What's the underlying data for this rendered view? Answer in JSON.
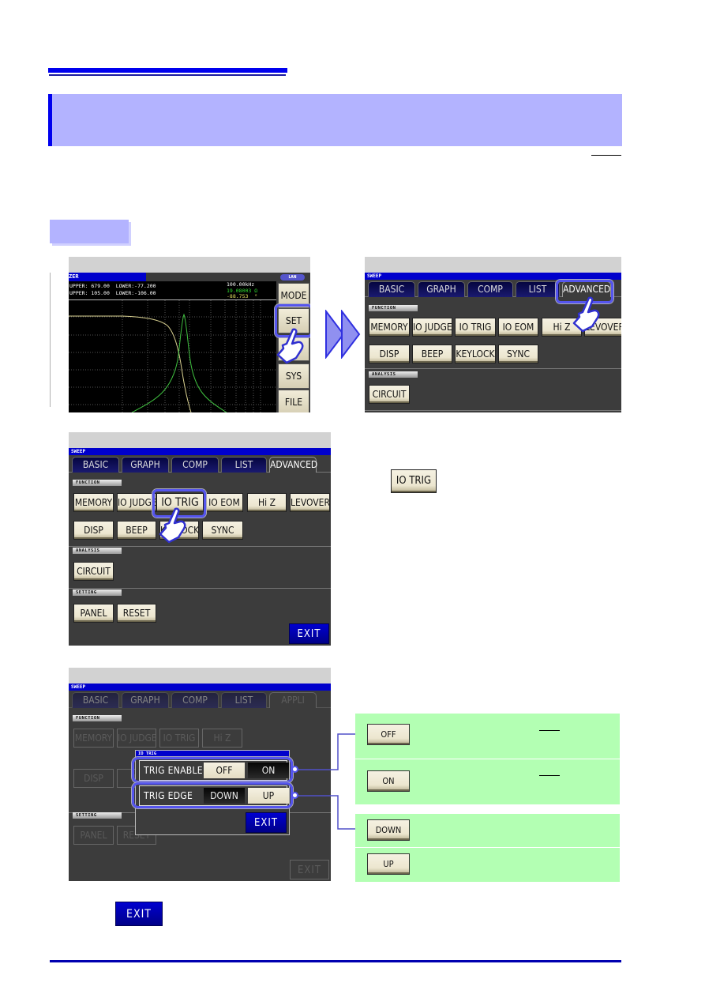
{
  "colors": {
    "accent_blue": "#0000ee",
    "section_band": "#b3b3ff",
    "explanation_green": "#b3ffb3",
    "highlight": "#5555ee",
    "screen_bg": "#3c3c3c"
  },
  "screen1": {
    "title": "ZER",
    "lan_badge": "LAN",
    "limits_line1": "UPPER: 679.00  LOWER:-77.200",
    "limits_line2": "UPPER: 105.00  LOWER:-106.00",
    "frequency": "100.00kHz",
    "value1": "19.08003 Ω",
    "value2": "-88.753  °",
    "side_buttons": [
      "MODE",
      "SET",
      "J",
      "SYS",
      "FILE"
    ],
    "highlighted_button": "SET"
  },
  "sweep_screen": {
    "title": "SWEEP",
    "tabs": [
      "BASIC",
      "GRAPH",
      "COMP",
      "LIST",
      "ADVANCED"
    ],
    "function_label": "FUNCTION",
    "function_row1": [
      "MEMORY",
      "IO JUDGE",
      "IO TRIG",
      "IO EOM",
      "Hi Z",
      "LEVOVER"
    ],
    "function_row2": [
      "DISP",
      "BEEP",
      "KEYLOCK",
      "SYNC"
    ],
    "analysis_label": "ANALYSIS",
    "analysis_buttons": [
      "CIRCUIT"
    ],
    "setting_label": "SETTING",
    "setting_buttons": [
      "PANEL",
      "RESET"
    ],
    "exit_label": "EXIT"
  },
  "screen4": {
    "title": "SWEEP",
    "tabs": [
      "BASIC",
      "GRAPH",
      "COMP",
      "LIST",
      "APPLI"
    ],
    "function_label": "FUNCTION",
    "function_row1": [
      "MEMORY",
      "IO JUDGE",
      "IO TRIG",
      "Hi Z"
    ],
    "function_row2": [
      "DISP",
      "B"
    ],
    "setting_label": "SETTING",
    "setting_buttons": [
      "PANEL",
      "RESET"
    ],
    "exit_label": "EXIT",
    "dialog": {
      "title": "IO TRIG",
      "trig_enable_label": "TRIG ENABLE",
      "trig_enable_options": [
        "OFF",
        "ON"
      ],
      "trig_enable_selected": "OFF",
      "trig_edge_label": "TRIG EDGE",
      "trig_edge_options": [
        "DOWN",
        "UP"
      ],
      "trig_edge_selected": "UP",
      "exit_label": "EXIT"
    }
  },
  "step2_button": "IO TRIG",
  "explanations": {
    "enable": [
      {
        "button": "OFF"
      },
      {
        "button": "ON"
      }
    ],
    "edge": [
      {
        "button": "DOWN"
      },
      {
        "button": "UP"
      }
    ]
  },
  "step_exit_button": "EXIT"
}
